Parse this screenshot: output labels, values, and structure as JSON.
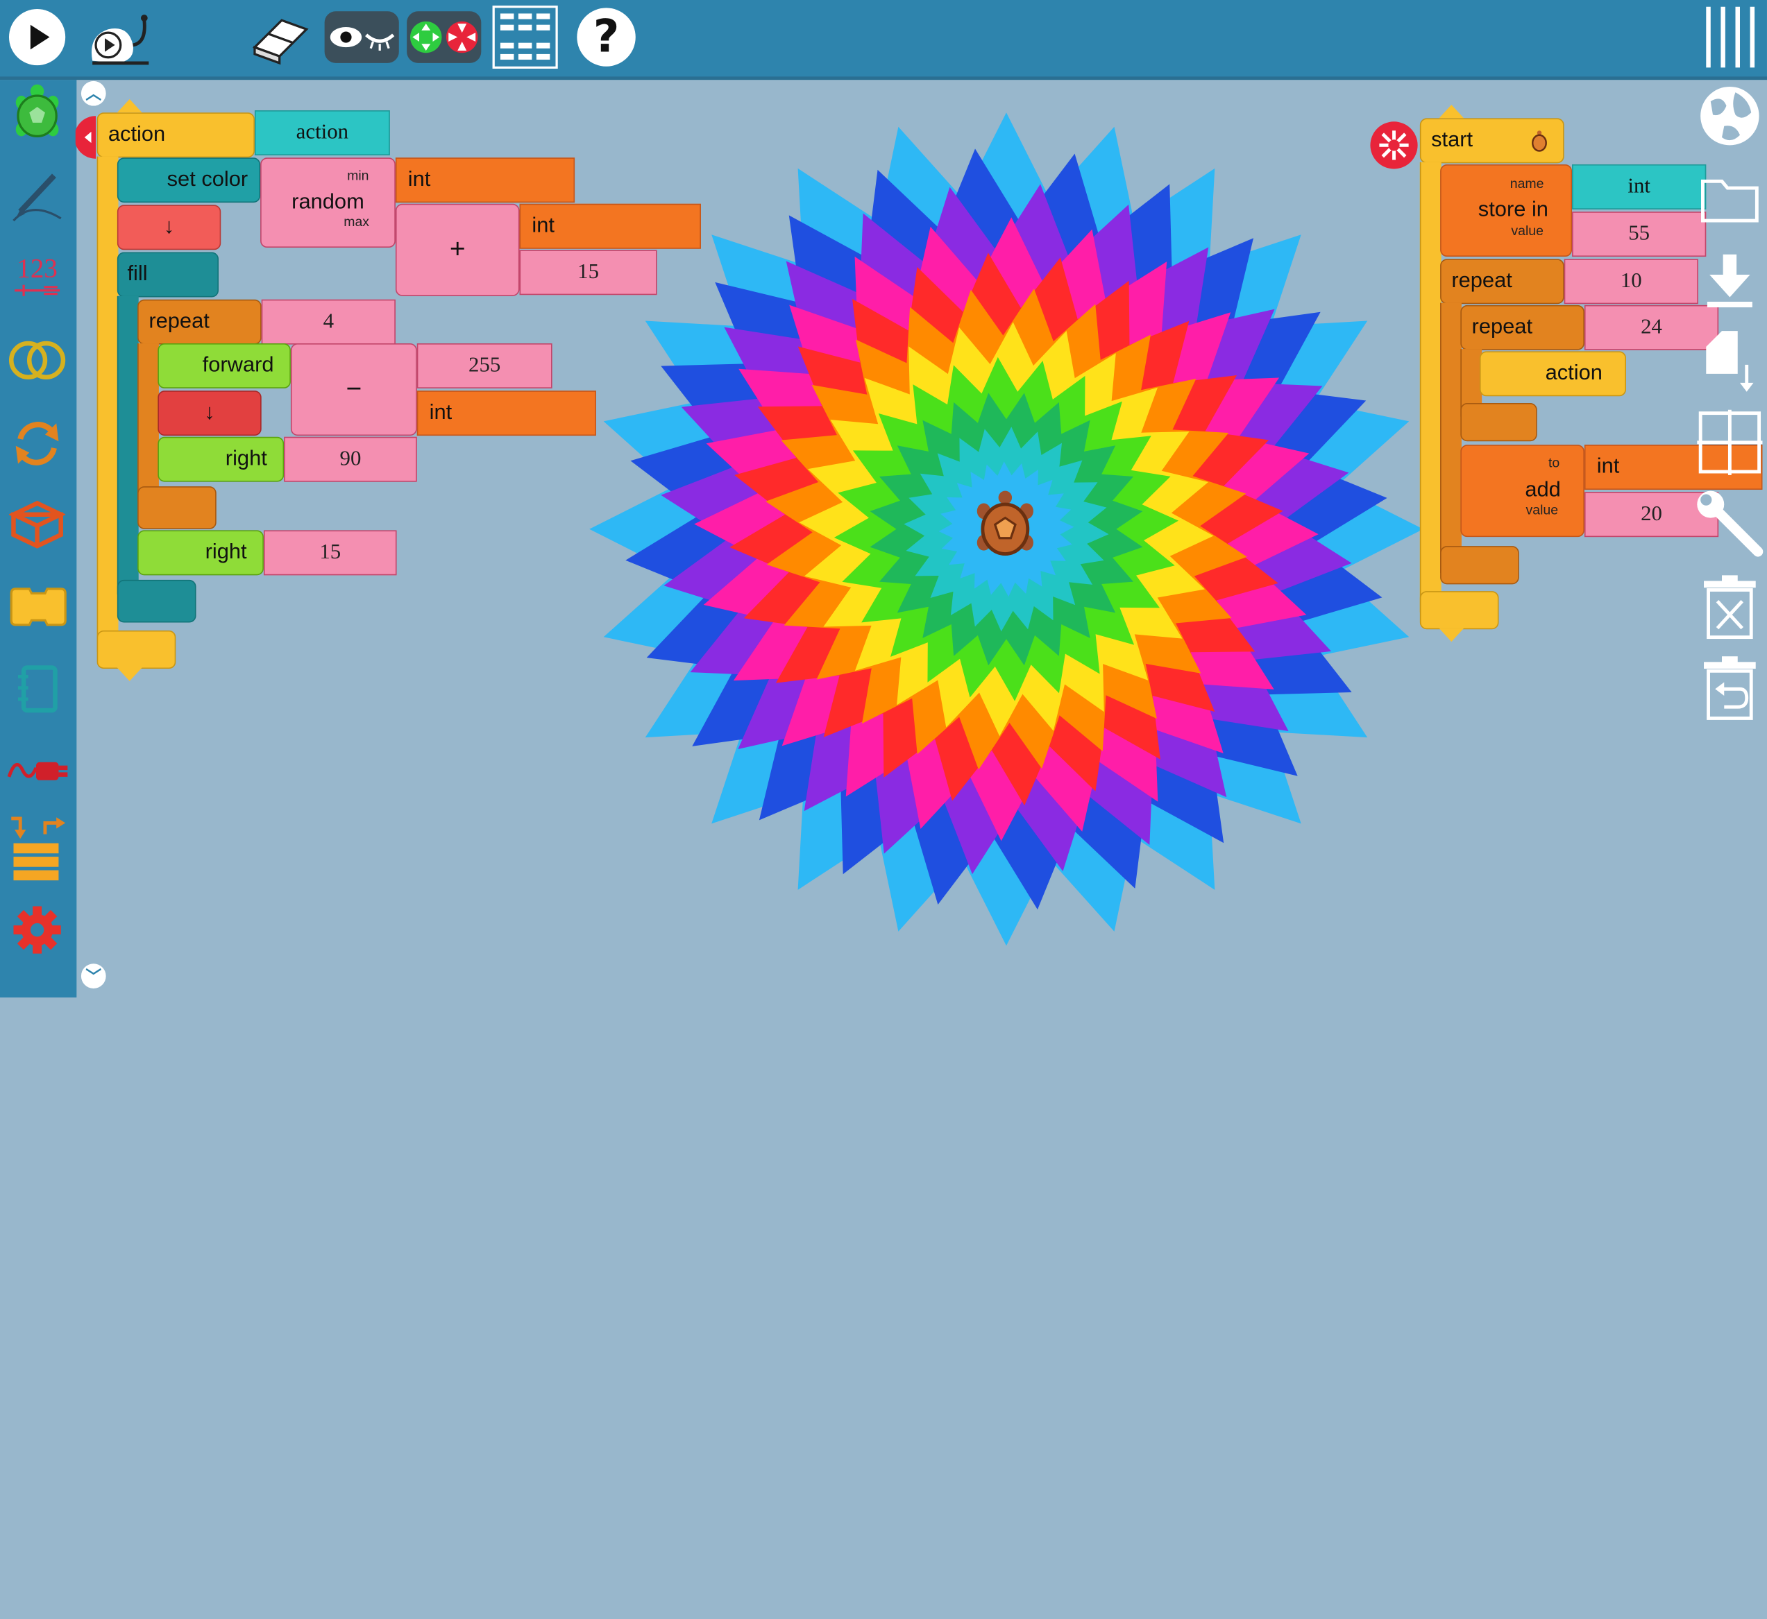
{
  "toolbar": {
    "icons": [
      "play-icon",
      "slow-run-icon",
      "eraser-icon",
      "eye-icon",
      "collapse-expand-icon",
      "grid-icon",
      "help-icon",
      "menu-icon"
    ],
    "help_glyph": "?"
  },
  "palette": {
    "items": [
      "turtle-icon",
      "pen-icon",
      "number-icon",
      "boolean-icon",
      "flow-icon",
      "box-icon",
      "action-icon",
      "notebook-icon",
      "sensor-icon",
      "blocks-icon",
      "settings-icon"
    ],
    "number_glyph": "123"
  },
  "action_stack": {
    "action_label": "action",
    "action_name": "action",
    "set_color_label": "set color",
    "random_label": "random",
    "random_min_label": "min",
    "random_max_label": "max",
    "random_min": "int",
    "plus_label": "+",
    "plus_a": "int",
    "plus_b": "15",
    "arrow_down_1": "↓",
    "fill_label": "fill",
    "repeat_label": "repeat",
    "repeat_count": "4",
    "forward_label": "forward",
    "minus_label": "−",
    "minus_a": "255",
    "minus_b": "int",
    "arrow_down_2": "↓",
    "right_label_1": "right",
    "right_value_1": "90",
    "right_label_2": "right",
    "right_value_2": "15"
  },
  "start_stack": {
    "start_label": "start",
    "store_in_label": "store in",
    "store_name_label": "name",
    "store_value_label": "value",
    "store_name": "int",
    "store_value": "55",
    "repeat_outer_label": "repeat",
    "repeat_outer_count": "10",
    "repeat_inner_label": "repeat",
    "repeat_inner_count": "24",
    "action_call_label": "action",
    "add_label": "add",
    "add_to_label": "to",
    "add_value_label": "value",
    "add_to": "int",
    "add_value": "20"
  },
  "right_tools": [
    "globe-icon",
    "folder-icon",
    "download-icon",
    "save-icon",
    "grid-crosshair-icon",
    "wrench-icon",
    "trash-icon",
    "restore-icon"
  ],
  "colors": {
    "toolbar": "#2e84ad",
    "workspace": "#98b7cc",
    "action_block": "#f9c02d",
    "pen_block": "#20a0a6",
    "number_block": "#f48fb1",
    "box_block": "#f37521",
    "flow_block": "#e2831f",
    "turtle_block": "#8fdc38"
  },
  "rainbow": [
    "#2eb8f5",
    "#1f4fe0",
    "#8a2be2",
    "#ff1ea8",
    "#ff2a2a",
    "#ff8a00",
    "#ffe21a",
    "#4be01a",
    "#1fb85a",
    "#22c5c5"
  ]
}
